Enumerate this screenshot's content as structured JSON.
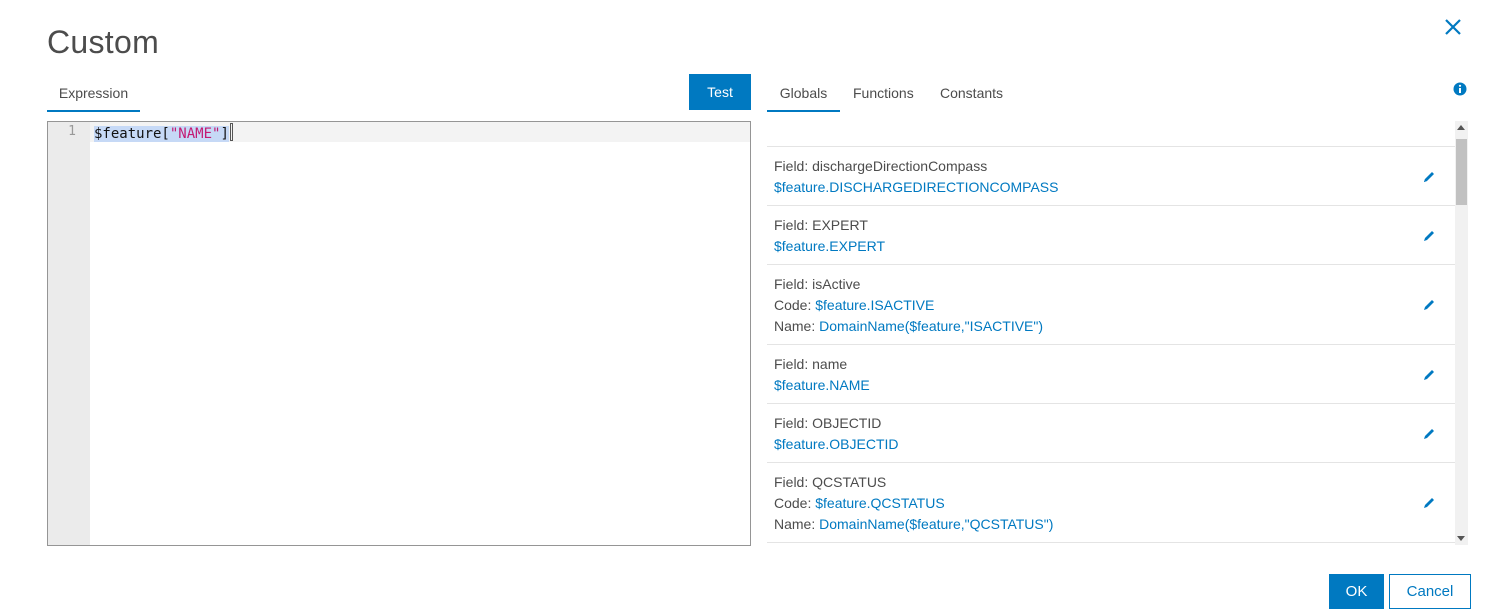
{
  "dialog": {
    "title": "Custom",
    "close_icon": "close-icon"
  },
  "left_panel": {
    "tabs": [
      {
        "label": "Expression",
        "active": true
      }
    ],
    "test_button": "Test",
    "editor": {
      "line_number": "1",
      "code_prefix": "$feature[",
      "code_string": "\"NAME\"",
      "code_suffix": "]"
    }
  },
  "right_panel": {
    "tabs": [
      {
        "label": "Globals",
        "active": true
      },
      {
        "label": "Functions",
        "active": false
      },
      {
        "label": "Constants",
        "active": false
      }
    ],
    "info_icon": "info-icon",
    "items": [
      {
        "field": "Field: discharge​DirectionCompass",
        "value": "$feature.DISCHARGEDIRECTIONCOMPASS"
      },
      {
        "field": "Field: EXPERT",
        "value": "$feature.EXPERT"
      },
      {
        "field": "Field: isActive",
        "code_label": "Code:",
        "code_value": "$feature.ISACTIVE",
        "name_label": "Name:",
        "name_value": "DomainName($feature,\"ISACTIVE\")"
      },
      {
        "field": "Field: name",
        "value": "$feature.NAME"
      },
      {
        "field": "Field: OBJECTID",
        "value": "$feature.OBJECTID"
      },
      {
        "field": "Field: QCSTATUS",
        "code_label": "Code:",
        "code_value": "$feature.QCSTATUS",
        "name_label": "Name:",
        "name_value": "DomainName($feature,\"QCSTATUS\")"
      }
    ]
  },
  "footer": {
    "ok_label": "OK",
    "cancel_label": "Cancel"
  },
  "colors": {
    "accent": "#0079c1",
    "text": "#4c4c4c",
    "string_literal": "#c41a73",
    "selection": "#c6d9f6"
  }
}
